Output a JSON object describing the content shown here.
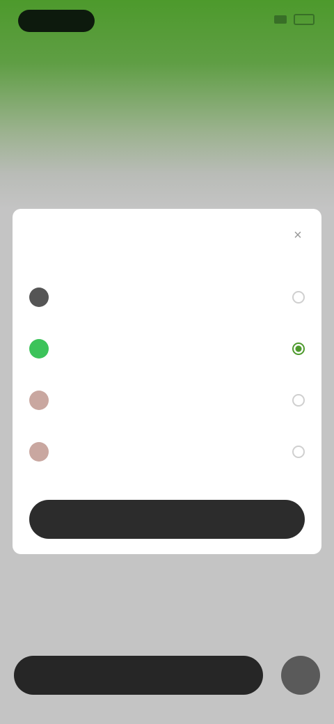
{
  "status_bar": {
    "time": ""
  },
  "promo": {
    "subtitle_prefix": "",
    "subtitle_highlight": "",
    "title": "",
    "caption": ""
  },
  "payment_sheet": {
    "title": "",
    "close_glyph": "×",
    "methods": [
      {
        "label": "",
        "icon": "wallet-icon",
        "icon_color": "#555555"
      },
      {
        "label": "",
        "icon": "wechat-icon",
        "icon_color": "#3cc35a"
      },
      {
        "label": "",
        "icon": "bank-card-icon",
        "icon_color": "#c9a7a0"
      },
      {
        "label": "",
        "icon": "bank-card-icon",
        "icon_color": "#c9a7a0"
      }
    ],
    "selected_index": 1,
    "pay_button": ""
  },
  "footer_note": {
    "text": "",
    "link": ""
  },
  "bottom_bar": {
    "action_label": "",
    "round_glyph": ""
  },
  "colors": {
    "brand_green": "#4d9a2c",
    "dark_button": "#2c2c2c"
  }
}
